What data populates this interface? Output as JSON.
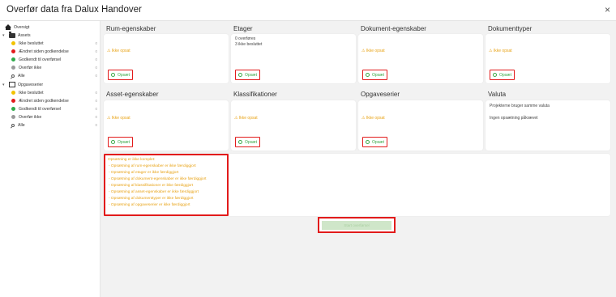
{
  "window": {
    "title": "Overfør data fra Dalux Handover",
    "close_glyph": "×"
  },
  "sidebar": {
    "overview_label": "Oversigt",
    "assets": {
      "label": "Assets",
      "items": [
        {
          "label": "Ikke besluttet",
          "color": "#f2c200"
        },
        {
          "label": "Ændret siden godkendelse",
          "color": "#e21b1b"
        },
        {
          "label": "Godkendt til overførsel",
          "color": "#2eaa4a"
        },
        {
          "label": "Overfør ikke",
          "color": "#9a9a9a"
        },
        {
          "label": "Alle",
          "icon": "search-icon"
        }
      ]
    },
    "tasks": {
      "label": "Opgaveserier",
      "items": [
        {
          "label": "Ikke besluttet",
          "color": "#f2c200"
        },
        {
          "label": "Ændret siden godkendelse",
          "color": "#e21b1b"
        },
        {
          "label": "Godkendt til overførsel",
          "color": "#2eaa4a"
        },
        {
          "label": "Overfør ikke",
          "color": "#9a9a9a"
        },
        {
          "label": "Alle",
          "icon": "search-icon"
        }
      ]
    },
    "counts": [
      "0",
      "0",
      "0",
      "0",
      "0",
      "0",
      "0",
      "0",
      "0",
      "0"
    ]
  },
  "sections": [
    {
      "title": "Rum-egenskaber",
      "status": "⚠ Ikke opsat",
      "button": "Opsæt"
    },
    {
      "title": "Etager",
      "info_lines": [
        "0 overføres",
        "3 ikke besluttet"
      ],
      "button": "Opsæt"
    },
    {
      "title": "Dokument-egenskaber",
      "status": "⚠ Ikke opsat",
      "button": "Opsæt"
    },
    {
      "title": "Dokumenttyper",
      "status": "⚠ Ikke opsat",
      "button": "Opsæt"
    },
    {
      "title": "Asset-egenskaber",
      "status": "⚠ Ikke opsat",
      "button": "Opsæt"
    },
    {
      "title": "Klassifikationer",
      "status": "⚠ Ikke opsat",
      "button": "Opsæt"
    },
    {
      "title": "Opgaveserier",
      "status": "⚠ Ikke opsat",
      "button": "Opsæt"
    },
    {
      "title": "Valuta",
      "info_lines": [
        "Projekterne bruger samme valuta",
        "",
        "Ingen opsætning påkrævet"
      ]
    }
  ],
  "warnings": {
    "header": "Opsætning er ikke komplet:",
    "lines": [
      "- Opsætning af rum-egenskaber er ikke færdiggjort",
      "- Opsætning af etager er ikke færdiggjort",
      "- Opsætning af dokument-egenskaber er ikke færdiggjort",
      "- Opsætning af klassifikationer er ikke færdiggjort",
      "- Opsætning af asset-egenskaber er ikke færdiggjort",
      "- Opsætning af dokumenttyper er ikke færdiggjort",
      "- Opsætning af opgaveserier er ikke færdiggjort"
    ]
  },
  "transfer_button": {
    "label": "Start overførsel",
    "enabled": false
  },
  "colors": {
    "warning": "#e8a317",
    "setup": "#3aa848",
    "highlight": "#e21b1b",
    "background": "#f2f2f2"
  }
}
